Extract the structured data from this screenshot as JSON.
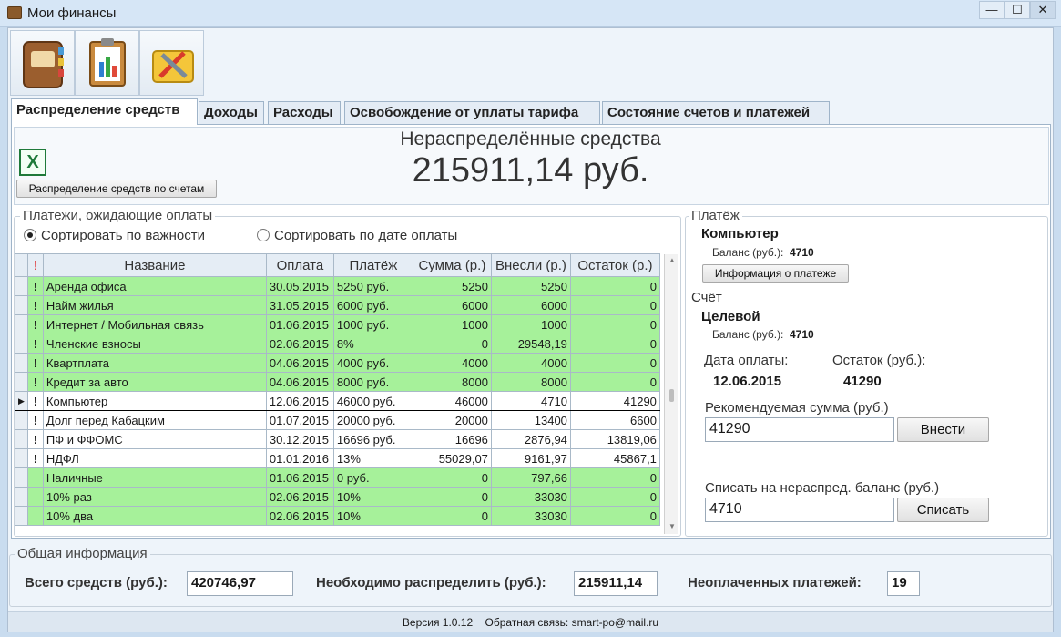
{
  "window": {
    "title": "Мои финансы",
    "minimize": "—",
    "maximize": "☐",
    "close": "✕"
  },
  "tabs": [
    "Распределение средств",
    "Доходы",
    "Расходы",
    "Освобождение от уплаты тарифа",
    "Состояние счетов и платежей"
  ],
  "summary": {
    "heading": "Нераспределённые средства",
    "amount": "215911,14 руб.",
    "distribute_button": "Распределение средств по счетам"
  },
  "payments": {
    "group_title": "Платежи, ожидающие оплаты",
    "sort_importance": "Сортировать по важности",
    "sort_date": "Сортировать по дате оплаты",
    "columns": [
      "!",
      "Название",
      "Оплата",
      "Платёж",
      "Сумма (р.)",
      "Внесли (р.)",
      "Остаток (р.)"
    ],
    "rows": [
      {
        "ex": "!",
        "name": "Аренда офиса",
        "date": "30.05.2015",
        "pay": "5250 руб.",
        "sum": "5250",
        "paid": "5250",
        "rest": "0",
        "color": "green"
      },
      {
        "ex": "!",
        "name": "Найм жилья",
        "date": "31.05.2015",
        "pay": "6000 руб.",
        "sum": "6000",
        "paid": "6000",
        "rest": "0",
        "color": "green"
      },
      {
        "ex": "!",
        "name": "Интернет / Мобильная связь",
        "date": "01.06.2015",
        "pay": "1000 руб.",
        "sum": "1000",
        "paid": "1000",
        "rest": "0",
        "color": "green"
      },
      {
        "ex": "!",
        "name": "Членские взносы",
        "date": "02.06.2015",
        "pay": "8%",
        "sum": "0",
        "paid": "29548,19",
        "rest": "0",
        "color": "green"
      },
      {
        "ex": "!",
        "name": "Квартплата",
        "date": "04.06.2015",
        "pay": "4000 руб.",
        "sum": "4000",
        "paid": "4000",
        "rest": "0",
        "color": "green"
      },
      {
        "ex": "!",
        "name": "Кредит за авто",
        "date": "04.06.2015",
        "pay": "8000 руб.",
        "sum": "8000",
        "paid": "8000",
        "rest": "0",
        "color": "green"
      },
      {
        "ex": "!",
        "name": "Компьютер",
        "date": "12.06.2015",
        "pay": "46000 руб.",
        "sum": "46000",
        "paid": "4710",
        "rest": "41290",
        "color": "white",
        "current": true
      },
      {
        "ex": "!",
        "name": "Долг перед Кабацким",
        "date": "01.07.2015",
        "pay": "20000 руб.",
        "sum": "20000",
        "paid": "13400",
        "rest": "6600",
        "color": "white"
      },
      {
        "ex": "!",
        "name": "ПФ и ФФОМС",
        "date": "30.12.2015",
        "pay": "16696 руб.",
        "sum": "16696",
        "paid": "2876,94",
        "rest": "13819,06",
        "color": "white"
      },
      {
        "ex": "!",
        "name": "НДФЛ",
        "date": "01.01.2016",
        "pay": "13%",
        "sum": "55029,07",
        "paid": "9161,97",
        "rest": "45867,1",
        "color": "white"
      },
      {
        "ex": "",
        "name": "Наличные",
        "date": "01.06.2015",
        "pay": "0 руб.",
        "sum": "0",
        "paid": "797,66",
        "rest": "0",
        "color": "green"
      },
      {
        "ex": "",
        "name": "10% раз",
        "date": "02.06.2015",
        "pay": "10%",
        "sum": "0",
        "paid": "33030",
        "rest": "0",
        "color": "green"
      },
      {
        "ex": "",
        "name": "10% два",
        "date": "02.06.2015",
        "pay": "10%",
        "sum": "0",
        "paid": "33030",
        "rest": "0",
        "color": "green"
      }
    ]
  },
  "payment_panel": {
    "group_title": "Платёж",
    "name": "Компьютер",
    "balance_label": "Баланс (руб.):",
    "balance_value": "4710",
    "info_button": "Информация о платеже",
    "account_title": "Счёт",
    "account_name": "Целевой",
    "account_balance_label": "Баланс (руб.):",
    "account_balance_value": "4710",
    "date_label": "Дата оплаты:",
    "date_value": "12.06.2015",
    "rest_label": "Остаток (руб.):",
    "rest_value": "41290",
    "recommended_label": "Рекомендуемая сумма (руб.)",
    "recommended_value": "41290",
    "deposit_button": "Внести",
    "writeoff_label": "Списать на нераспред. баланс (руб.)",
    "writeoff_value": "4710",
    "writeoff_button": "Списать"
  },
  "general": {
    "group_title": "Общая информация",
    "total_label": "Всего средств (руб.):",
    "total_value": "420746,97",
    "need_label": "Необходимо распределить (руб.):",
    "need_value": "215911,14",
    "unpaid_label": "Неоплаченных платежей:",
    "unpaid_value": "19"
  },
  "status": {
    "version": "Версия 1.0.12",
    "feedback": "Обратная связь: smart-po@mail.ru"
  }
}
